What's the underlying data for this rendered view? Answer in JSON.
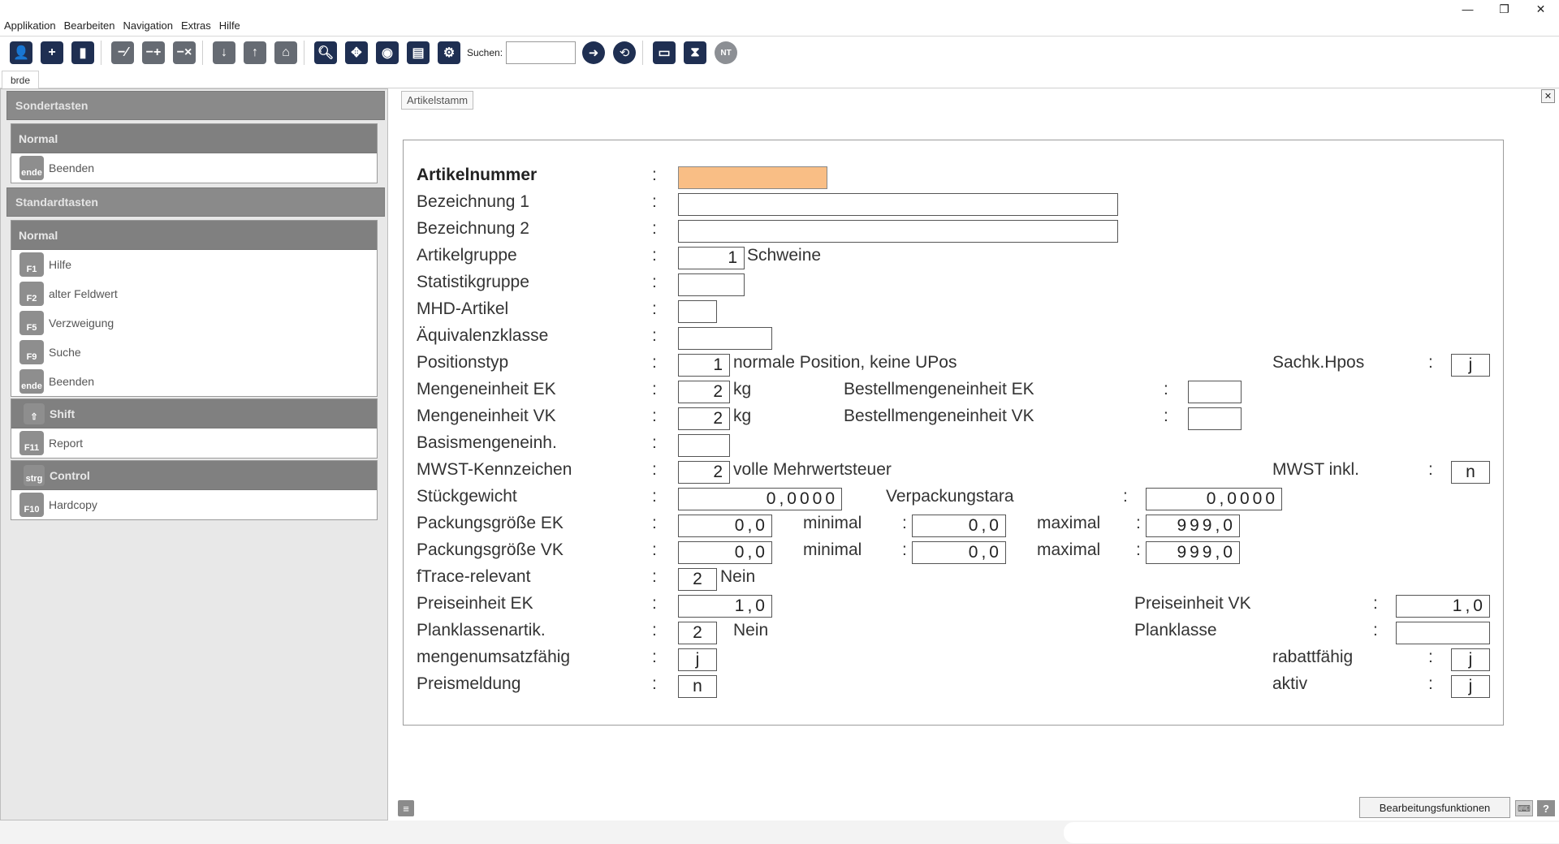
{
  "window": {
    "controls": [
      "—",
      "❐",
      "✕"
    ]
  },
  "menu": [
    "Applikation",
    "Bearbeiten",
    "Navigation",
    "Extras",
    "Hilfe"
  ],
  "toolbar": {
    "search_label": "Suchen:",
    "search_value": "",
    "nt_badge": "NT"
  },
  "tab": {
    "label": "brde"
  },
  "left_panel": {
    "sondertasten": {
      "header": "Sondertasten",
      "groups": [
        {
          "title": "Normal",
          "items": [
            {
              "key": "ende",
              "label": "Beenden"
            }
          ]
        }
      ]
    },
    "standardtasten": {
      "header": "Standardtasten",
      "normal": {
        "title": "Normal",
        "items": [
          {
            "key": "F1",
            "label": "Hilfe"
          },
          {
            "key": "F2",
            "label": "alter Feldwert"
          },
          {
            "key": "F5",
            "label": "Verzweigung"
          },
          {
            "key": "F9",
            "label": "Suche"
          },
          {
            "key": "ende",
            "label": "Beenden"
          }
        ]
      },
      "shift": {
        "key": "⇧",
        "title": "Shift",
        "items": [
          {
            "key": "F11",
            "label": "Report"
          }
        ]
      },
      "control": {
        "key": "strg",
        "title": "Control",
        "items": [
          {
            "key": "F10",
            "label": "Hardcopy"
          }
        ]
      }
    }
  },
  "form": {
    "tab_label": "Artikelstamm",
    "colon": ":",
    "artikelnummer": {
      "label": "Artikelnummer",
      "value": ""
    },
    "bezeichnung1": {
      "label": "Bezeichnung 1",
      "value": ""
    },
    "bezeichnung2": {
      "label": "Bezeichnung 2",
      "value": ""
    },
    "artikelgruppe": {
      "label": "Artikelgruppe",
      "value": "1",
      "text": "Schweine"
    },
    "statistikgruppe": {
      "label": "Statistikgruppe",
      "value": ""
    },
    "mhd_artikel": {
      "label": "MHD-Artikel",
      "value": ""
    },
    "aequivalenzklasse": {
      "label": "Äquivalenzklasse",
      "value": ""
    },
    "positionstyp": {
      "label": "Positionstyp",
      "value": "1",
      "text": "normale Position, keine UPos"
    },
    "sachk_hpos": {
      "label": "Sachk.Hpos",
      "value": "j"
    },
    "mengeneinheit_ek": {
      "label": "Mengeneinheit EK",
      "value": "2",
      "text": "kg"
    },
    "bestellmengeneinheit_ek": {
      "label": "Bestellmengeneinheit EK",
      "value": ""
    },
    "mengeneinheit_vk": {
      "label": "Mengeneinheit VK",
      "value": "2",
      "text": "kg"
    },
    "bestellmengeneinheit_vk": {
      "label": "Bestellmengeneinheit VK",
      "value": ""
    },
    "basismengeneinh": {
      "label": "Basismengeneinh.",
      "value": ""
    },
    "mwst_kennzeichen": {
      "label": "MWST-Kennzeichen",
      "value": "2",
      "text": "volle Mehrwertsteuer"
    },
    "mwst_inkl": {
      "label": "MWST inkl.",
      "value": "n"
    },
    "stueckgewicht": {
      "label": "Stückgewicht",
      "value": "0,0000"
    },
    "verpackungstara": {
      "label": "Verpackungstara",
      "value": "0,0000"
    },
    "packungsgroesse_ek": {
      "label": "Packungsgröße EK",
      "value": "0,0",
      "min_label": "minimal",
      "min": "0,0",
      "max_label": "maximal",
      "max": "999,0"
    },
    "packungsgroesse_vk": {
      "label": "Packungsgröße VK",
      "value": "0,0",
      "min_label": "minimal",
      "min": "0,0",
      "max_label": "maximal",
      "max": "999,0"
    },
    "ftrace_relevant": {
      "label": "fTrace-relevant",
      "value": "2",
      "text": "Nein"
    },
    "preiseinheit_ek": {
      "label": "Preiseinheit  EK",
      "value": "1,0"
    },
    "preiseinheit_vk": {
      "label": "Preiseinheit  VK",
      "value": "1,0"
    },
    "planklassenartik": {
      "label": "Planklassenartik.",
      "value": "2",
      "text": "Nein"
    },
    "planklasse": {
      "label": "Planklasse",
      "value": ""
    },
    "mengenumsatzfaehig": {
      "label": "mengenumsatzfähig",
      "value": "j"
    },
    "rabattfaehig": {
      "label": "rabattfähig",
      "value": "j"
    },
    "preismeldung": {
      "label": "Preismeldung",
      "value": "n"
    },
    "aktiv": {
      "label": "aktiv",
      "value": "j"
    }
  },
  "footer": {
    "button_label": "Bearbeitungsfunktionen"
  },
  "colors": {
    "accent": "#1f2f52",
    "highlight_field": "#f9be85",
    "panel_header": "#8a8a8a"
  }
}
